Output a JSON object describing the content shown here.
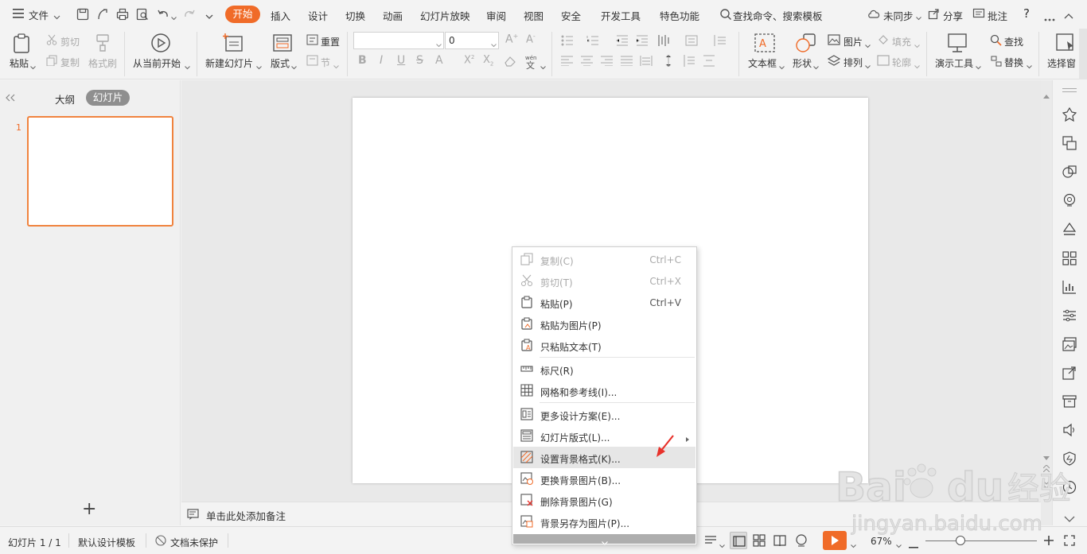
{
  "topbar": {
    "menu_label": "文件",
    "tabs": [
      "开始",
      "插入",
      "设计",
      "切换",
      "动画",
      "幻灯片放映",
      "审阅",
      "视图",
      "安全",
      "开发工具",
      "特色功能"
    ],
    "search_placeholder": "查找命令、搜索模板",
    "sync_label": "未同步",
    "share_label": "分享",
    "comment_label": "批注",
    "help_label": "?"
  },
  "ribbon": {
    "paste": "粘贴",
    "cut": "剪切",
    "copy": "复制",
    "format_painter": "格式刷",
    "from_current": "从当前开始",
    "new_slide": "新建幻灯片",
    "layout": "版式",
    "reset": "重置",
    "section": "节",
    "font_size": "0",
    "text_box": "文本框",
    "shape": "形状",
    "picture": "图片",
    "fill": "填充",
    "arrange": "排列",
    "outline": "轮廓",
    "present_tools": "演示工具",
    "find": "查找",
    "replace": "替换",
    "select_pane": "选择窗"
  },
  "leftpanel": {
    "outline_tab": "大纲",
    "slides_tab": "幻灯片",
    "slide_number": "1",
    "add_label": "+"
  },
  "notes": {
    "placeholder": "单击此处添加备注"
  },
  "context_menu": {
    "items": [
      {
        "label": "复制(C)",
        "shortcut": "Ctrl+C",
        "disabled": true
      },
      {
        "label": "剪切(T)",
        "shortcut": "Ctrl+X",
        "disabled": true
      },
      {
        "label": "粘贴(P)",
        "shortcut": "Ctrl+V",
        "disabled": false
      },
      {
        "label": "粘贴为图片(P)",
        "shortcut": "",
        "disabled": false
      },
      {
        "label": "只粘贴文本(T)",
        "shortcut": "",
        "disabled": false
      },
      {
        "label": "标尺(R)",
        "shortcut": "",
        "disabled": false
      },
      {
        "label": "网格和参考线(I)...",
        "shortcut": "",
        "disabled": false
      },
      {
        "label": "更多设计方案(E)...",
        "shortcut": "",
        "disabled": false
      },
      {
        "label": "幻灯片版式(L)...",
        "shortcut": "",
        "disabled": false
      },
      {
        "label": "设置背景格式(K)...",
        "shortcut": "",
        "disabled": false
      },
      {
        "label": "更换背景图片(B)...",
        "shortcut": "",
        "disabled": false
      },
      {
        "label": "删除背景图片(G)",
        "shortcut": "",
        "disabled": false
      },
      {
        "label": "背景另存为图片(P)...",
        "shortcut": "",
        "disabled": false
      }
    ]
  },
  "statusbar": {
    "slide_info": "幻灯片 1 / 1",
    "template": "默认设计模板",
    "protect": "文档未保护",
    "zoom": "67%"
  },
  "watermark": {
    "brand": "Bai du 经验",
    "url": "jingyan.baidu.com"
  },
  "colors": {
    "accent": "#f06b28",
    "arrow": "#e8322b"
  }
}
